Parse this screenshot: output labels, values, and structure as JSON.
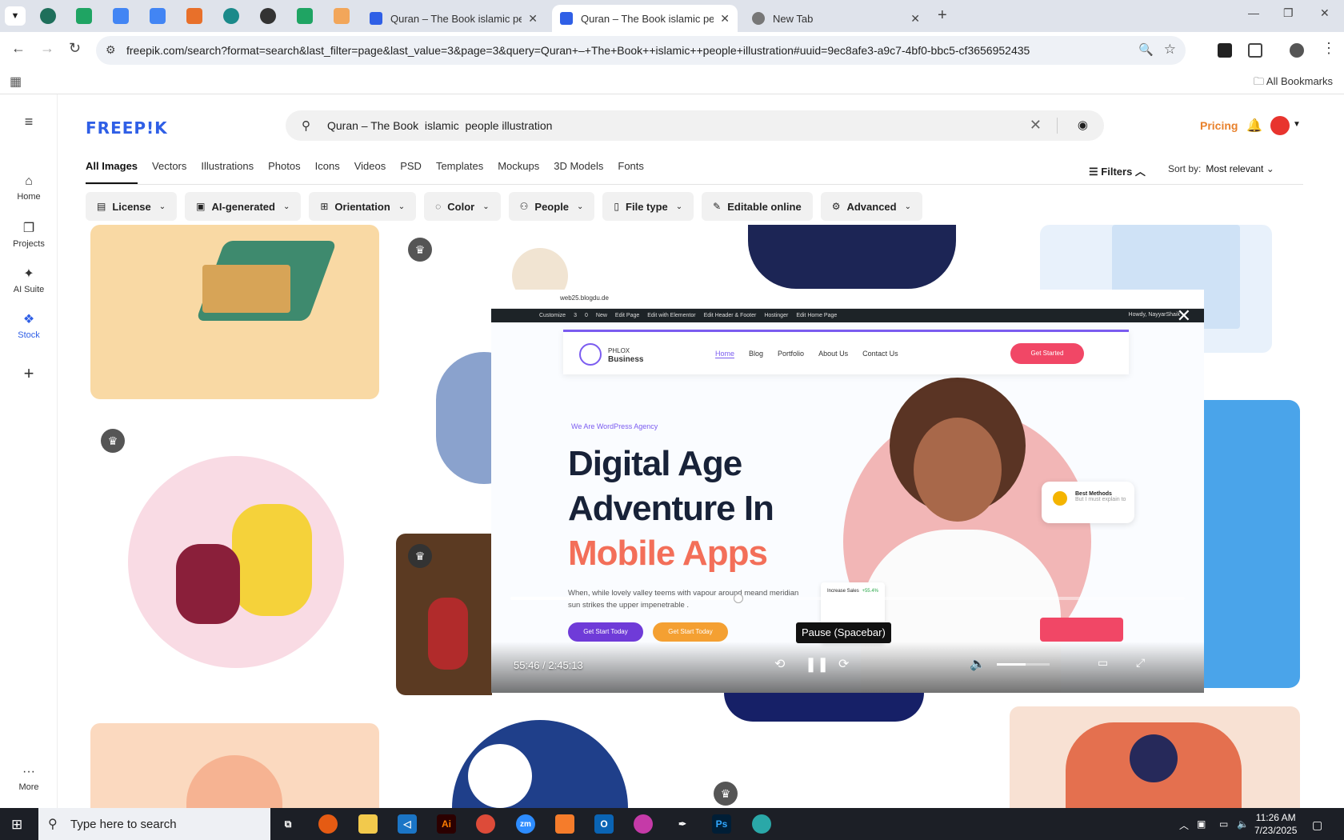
{
  "browser": {
    "tabs": [
      {
        "title": "Quran – The Book islamic peop",
        "active": false
      },
      {
        "title": "Quran – The Book islamic peop",
        "active": true
      },
      {
        "title": "New Tab",
        "active": false
      }
    ],
    "url": "freepik.com/search?format=search&last_filter=page&last_value=3&page=3&query=Quran+–+The+Book++islamic++people+illustration#uuid=9ec8afe3-a9c7-4bf0-bbc5-cf3656952435",
    "all_bookmarks": "All Bookmarks"
  },
  "sidenav": {
    "items": [
      {
        "label": "Home",
        "icon": "home-icon"
      },
      {
        "label": "Projects",
        "icon": "projects-icon"
      },
      {
        "label": "AI Suite",
        "icon": "sparkle-icon"
      },
      {
        "label": "Stock",
        "icon": "stock-icon"
      }
    ],
    "more": "More"
  },
  "header": {
    "logo": "FREEP!K",
    "search_query": "Quran – The Book  islamic  people illustration",
    "pricing": "Pricing"
  },
  "type_tabs": [
    "All Images",
    "Vectors",
    "Illustrations",
    "Photos",
    "Icons",
    "Videos",
    "PSD",
    "Templates",
    "Mockups",
    "3D Models",
    "Fonts"
  ],
  "filters_label": "Filters",
  "sort": {
    "label": "Sort by:",
    "value": "Most relevant"
  },
  "chips": [
    {
      "label": "License",
      "icon": "license-icon"
    },
    {
      "label": "AI-generated",
      "icon": "ai-icon"
    },
    {
      "label": "Orientation",
      "icon": "orientation-icon"
    },
    {
      "label": "Color",
      "icon": "color-icon"
    },
    {
      "label": "People",
      "icon": "people-icon"
    },
    {
      "label": "File type",
      "icon": "file-icon"
    },
    {
      "label": "Editable online",
      "icon": "edit-icon"
    },
    {
      "label": "Advanced",
      "icon": "gear-icon"
    }
  ],
  "video": {
    "inner_url": "web25.blogdu.de",
    "wp_bar": [
      "Customize",
      "3",
      "0",
      "New",
      "Edit Page",
      "Edit with Elementor",
      "Edit Header & Footer",
      "Hostinger",
      "Edit Home Page"
    ],
    "howdy": "Howdy, NayyarShaik",
    "brand_top": "PHLOX",
    "brand_bottom": "Business",
    "menu": [
      "Home",
      "Blog",
      "Portfolio",
      "About Us",
      "Contact Us"
    ],
    "cta": "Get Started",
    "agency": "We Are WordPress Agency",
    "headline_1": "Digital Age",
    "headline_2": "Adventure In",
    "headline_3": "Mobile Apps",
    "body": "When, while lovely valley teems with vapour around meand meridian sun strikes the upper impenetrable .",
    "btn1": "Get Start Today",
    "btn2": "Get Start Today",
    "card_title": "Best Methods",
    "card_sub": "But I must explain to",
    "sales_title": "Increase Sales",
    "sales_pct": "+55.4%",
    "time": "55:46 / 2:45:13",
    "progress": 0.338,
    "volume": 0.55,
    "tooltip": "Pause (Spacebar)"
  },
  "taskbar": {
    "search_placeholder": "Type here to search",
    "time": "11:26 AM",
    "date": "7/23/2025"
  }
}
